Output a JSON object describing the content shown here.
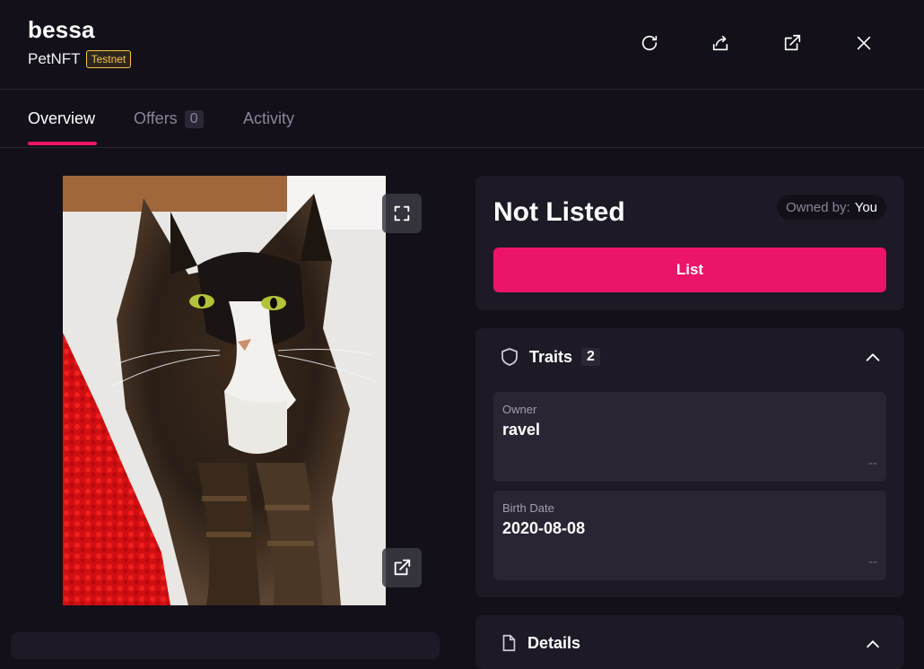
{
  "header": {
    "title": "bessa",
    "collection": "PetNFT",
    "badge": "Testnet"
  },
  "toolbar_icons": [
    "refresh-icon",
    "share-icon",
    "external-link-icon",
    "close-icon"
  ],
  "tabs": [
    {
      "label": "Overview",
      "active": true
    },
    {
      "label": "Offers",
      "count": "0",
      "active": false
    },
    {
      "label": "Activity",
      "active": false
    }
  ],
  "image": {
    "description": "calico cat lying on red rug",
    "buttons": [
      "fullscreen-icon",
      "open-external-icon"
    ]
  },
  "listing": {
    "status": "Not Listed",
    "owned_by_label": "Owned by:",
    "owned_by_value": "You",
    "list_button": "List"
  },
  "traits": {
    "title": "Traits",
    "count": "2",
    "items": [
      {
        "type": "Owner",
        "value": "ravel",
        "rarity": "--"
      },
      {
        "type": "Birth Date",
        "value": "2020-08-08",
        "rarity": "--"
      }
    ]
  },
  "details": {
    "title": "Details"
  },
  "colors": {
    "background": "#13101a",
    "card": "#1d1a26",
    "accent": "#ec1468",
    "badge": "#f5c542"
  }
}
